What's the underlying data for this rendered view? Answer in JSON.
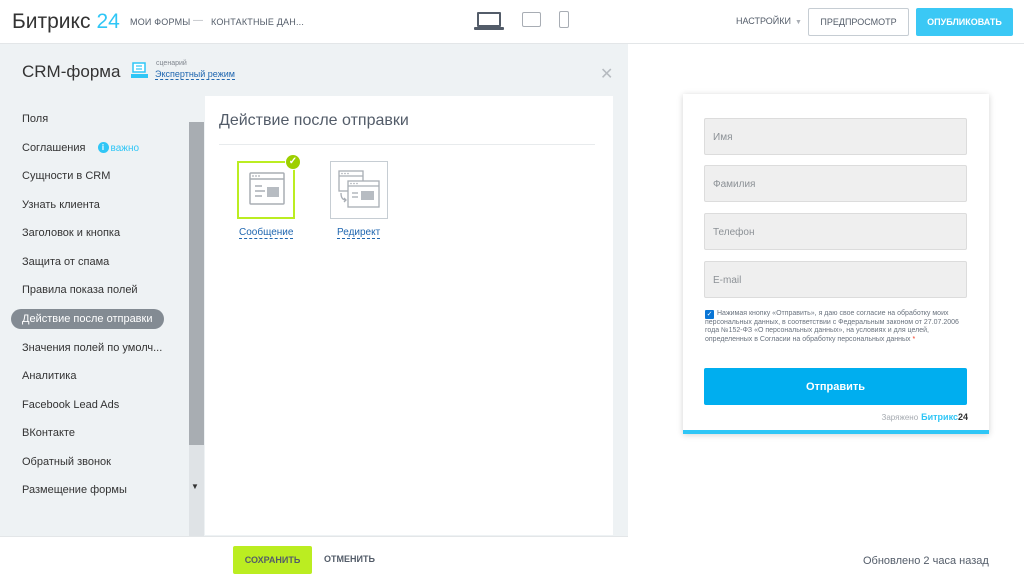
{
  "header": {
    "logo_text": "Битрикс",
    "logo_num": "24",
    "nav_forms": "МОИ ФОРМЫ",
    "nav_separator": "—",
    "nav_current": "КОНТАКТНЫЕ ДАН...",
    "settings_label": "НАСТРОЙКИ",
    "preview_label": "ПРЕДПРОСМОТР",
    "publish_label": "ОПУБЛИКОВАТЬ",
    "devices": [
      "laptop-icon",
      "tablet-icon",
      "phone-icon"
    ],
    "active_device": "laptop"
  },
  "editor": {
    "title": "CRM-форма",
    "scenario_small": "сценарий",
    "scenario_link": "Экспертный режим",
    "nav_items": [
      {
        "label": "Поля"
      },
      {
        "label": "Соглашения",
        "badge": "важно"
      },
      {
        "label": "Сущности в CRM"
      },
      {
        "label": "Узнать клиента"
      },
      {
        "label": "Заголовок и кнопка"
      },
      {
        "label": "Защита от спама"
      },
      {
        "label": "Правила показа полей"
      },
      {
        "label": "Действие после отправки",
        "active": true
      },
      {
        "label": "Значения полей по умолч..."
      },
      {
        "label": "Аналитика"
      },
      {
        "label": "Facebook Lead Ads"
      },
      {
        "label": "ВКонтакте"
      },
      {
        "label": "Обратный звонок"
      },
      {
        "label": "Размещение формы"
      }
    ],
    "section_title": "Действие после отправки",
    "options": [
      {
        "label": "Сообщение",
        "selected": true,
        "icon": "message-window-icon"
      },
      {
        "label": "Редирект",
        "selected": false,
        "icon": "redirect-window-icon"
      }
    ],
    "save_label": "СОХРАНИТЬ",
    "cancel_label": "ОТМЕНИТЬ"
  },
  "preview": {
    "fields": [
      {
        "placeholder": "Имя"
      },
      {
        "placeholder": "Фамилия"
      },
      {
        "placeholder": "Телефон"
      },
      {
        "placeholder": "E-mail"
      }
    ],
    "consent_checked": true,
    "consent_text": "Нажимая кнопку «Отправить», я даю свое согласие на обработку моих персональных данных, в соответствии с Федеральным законом от 27.07.2006 года №152-ФЗ «О персональных данных», на условиях и для целей, определенных в Согласии на обработку персональных данных",
    "consent_required_mark": "*",
    "submit_label": "Отправить",
    "powered_by": "Заряжено",
    "powered_brand": "Битрикс",
    "powered_brand_num": "24"
  },
  "status": {
    "updated": "Обновлено 2 часа назад"
  },
  "colors": {
    "accent_blue": "#2fc6f6",
    "publish_blue": "#3bc8f5",
    "submit_blue": "#00aeef",
    "save_green": "#bbed21",
    "active_nav_gray": "#838b93",
    "link_blue": "#2067b0"
  }
}
